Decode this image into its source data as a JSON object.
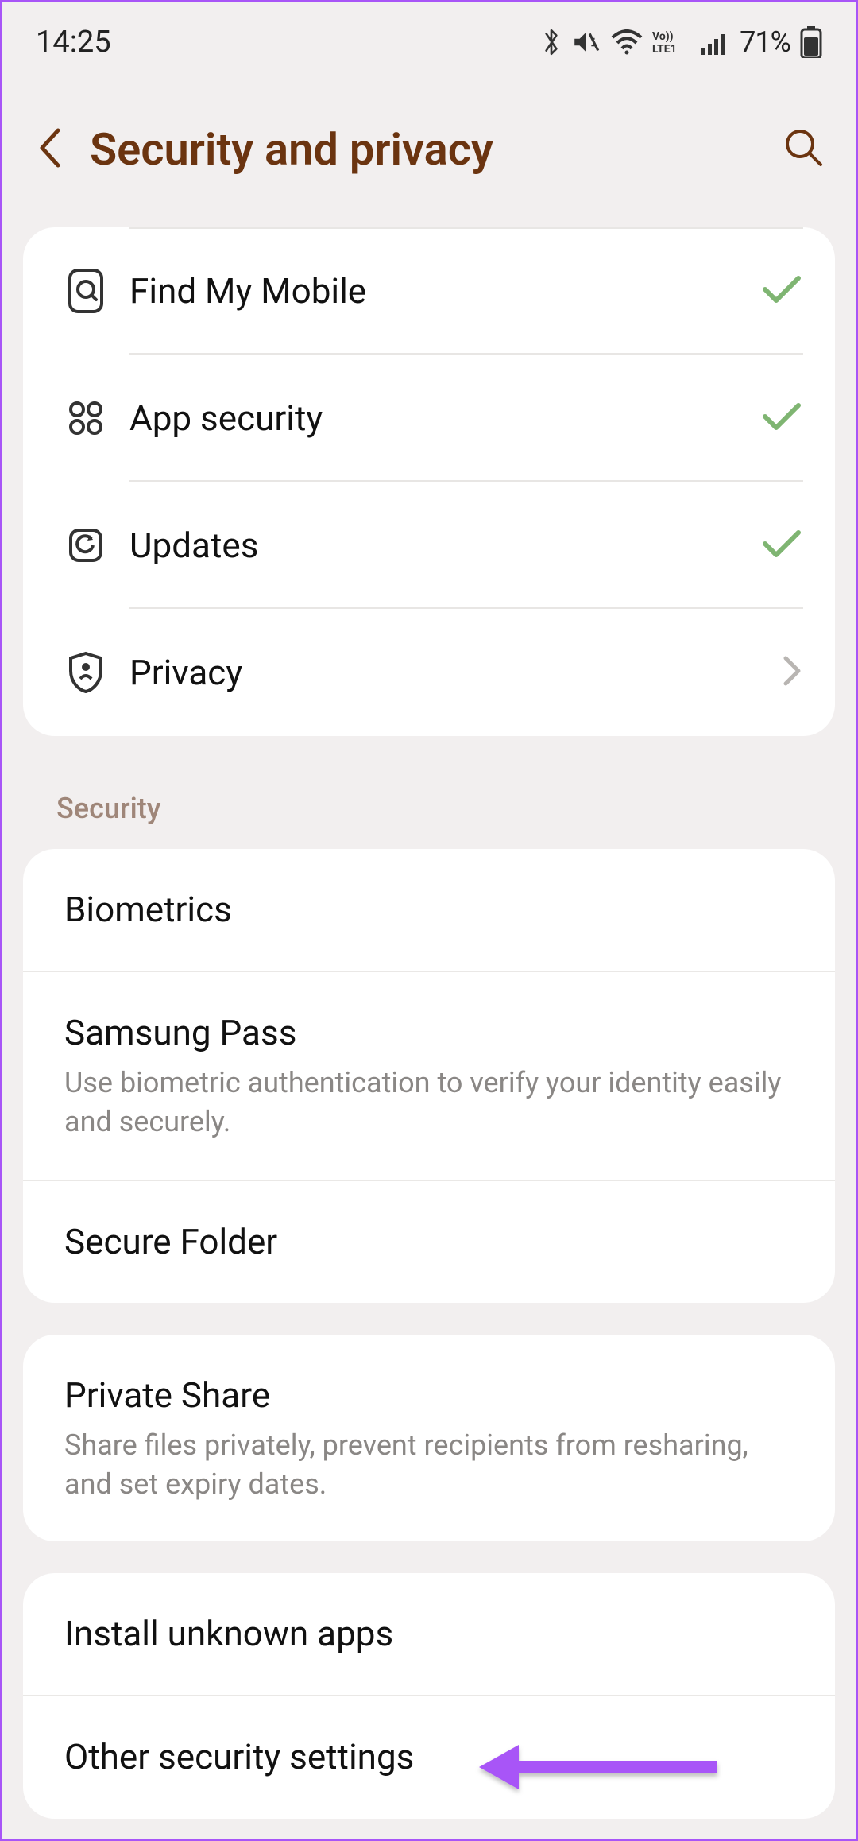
{
  "status_bar": {
    "time": "14:25",
    "battery_text": "71%"
  },
  "header": {
    "title": "Security and privacy"
  },
  "dashboard": [
    {
      "label": "Find My Mobile",
      "status": "ok"
    },
    {
      "label": "App security",
      "status": "ok"
    },
    {
      "label": "Updates",
      "status": "ok"
    },
    {
      "label": "Privacy",
      "status": "chevron"
    }
  ],
  "sections": [
    {
      "label": "Security",
      "items": [
        {
          "title": "Biometrics"
        },
        {
          "title": "Samsung Pass",
          "subtitle": "Use biometric authentication to verify your identity easily and securely."
        },
        {
          "title": "Secure Folder"
        }
      ]
    },
    {
      "items": [
        {
          "title": "Private Share",
          "subtitle": "Share files privately, prevent recipients from resharing, and set expiry dates."
        }
      ]
    },
    {
      "items": [
        {
          "title": "Install unknown apps"
        },
        {
          "title": "Other security settings"
        }
      ]
    }
  ]
}
